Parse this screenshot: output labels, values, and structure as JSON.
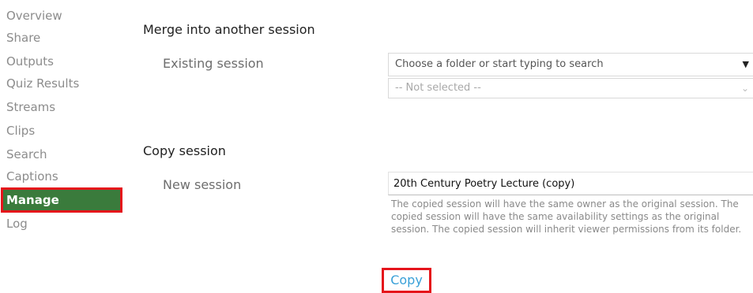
{
  "sidebar": {
    "items": [
      {
        "label": "Overview"
      },
      {
        "label": "Share"
      },
      {
        "label": "Outputs"
      },
      {
        "label": "Quiz Results"
      },
      {
        "label": "Streams"
      },
      {
        "label": "Clips"
      },
      {
        "label": "Search"
      },
      {
        "label": "Captions"
      },
      {
        "label": "Manage",
        "active": true
      },
      {
        "label": "Log"
      }
    ]
  },
  "merge": {
    "title": "Merge into another session",
    "existing_label": "Existing session",
    "folder_placeholder": "Choose a folder or start typing to search",
    "session_select_value": "-- Not selected --"
  },
  "copy": {
    "title": "Copy session",
    "new_label": "New session",
    "new_session_value": "20th Century Poetry Lecture (copy)",
    "description": "The copied session will have the same owner as the original session. The copied session will have the same availability settings as the original session. The copied session will inherit viewer permissions from its folder.",
    "button_label": "Copy"
  },
  "colors": {
    "active_bg": "#3a7b3c",
    "highlight_border": "#e5141b",
    "link": "#3aa0d8"
  }
}
